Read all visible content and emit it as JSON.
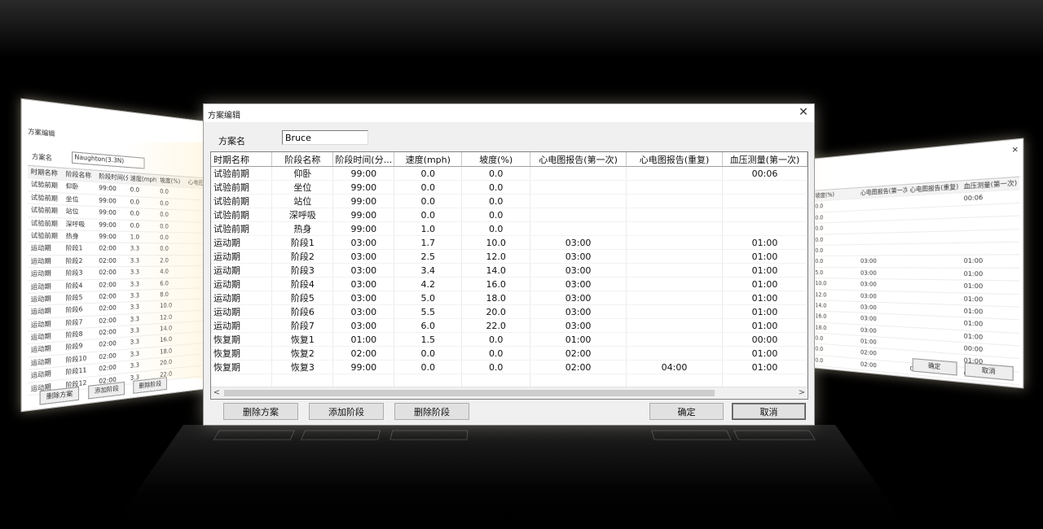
{
  "dialog": {
    "title": "方案编辑",
    "close_glyph": "✕",
    "plan_label": "方案名",
    "plan_value": "Bruce",
    "columns": [
      "时期名称",
      "阶段名称",
      "阶段时间(分...",
      "速度(mph)",
      "坡度(%)",
      "心电图报告(第一次)",
      "心电图报告(重复)",
      "血压测量(第一次)"
    ],
    "rows": [
      [
        "试验前期",
        "仰卧",
        "99:00",
        "0.0",
        "0.0",
        "",
        "",
        "00:06"
      ],
      [
        "试验前期",
        "坐位",
        "99:00",
        "0.0",
        "0.0",
        "",
        "",
        ""
      ],
      [
        "试验前期",
        "站位",
        "99:00",
        "0.0",
        "0.0",
        "",
        "",
        ""
      ],
      [
        "试验前期",
        "深呼吸",
        "99:00",
        "0.0",
        "0.0",
        "",
        "",
        ""
      ],
      [
        "试验前期",
        "热身",
        "99:00",
        "1.0",
        "0.0",
        "",
        "",
        ""
      ],
      [
        "运动期",
        "阶段1",
        "03:00",
        "1.7",
        "10.0",
        "03:00",
        "",
        "01:00"
      ],
      [
        "运动期",
        "阶段2",
        "03:00",
        "2.5",
        "12.0",
        "03:00",
        "",
        "01:00"
      ],
      [
        "运动期",
        "阶段3",
        "03:00",
        "3.4",
        "14.0",
        "03:00",
        "",
        "01:00"
      ],
      [
        "运动期",
        "阶段4",
        "03:00",
        "4.2",
        "16.0",
        "03:00",
        "",
        "01:00"
      ],
      [
        "运动期",
        "阶段5",
        "03:00",
        "5.0",
        "18.0",
        "03:00",
        "",
        "01:00"
      ],
      [
        "运动期",
        "阶段6",
        "03:00",
        "5.5",
        "20.0",
        "03:00",
        "",
        "01:00"
      ],
      [
        "运动期",
        "阶段7",
        "03:00",
        "6.0",
        "22.0",
        "03:00",
        "",
        "01:00"
      ],
      [
        "恢复期",
        "恢复1",
        "01:00",
        "1.5",
        "0.0",
        "01:00",
        "",
        "00:00"
      ],
      [
        "恢复期",
        "恢复2",
        "02:00",
        "0.0",
        "0.0",
        "02:00",
        "",
        "01:00"
      ],
      [
        "恢复期",
        "恢复3",
        "99:00",
        "0.0",
        "0.0",
        "02:00",
        "04:00",
        "01:00"
      ]
    ],
    "buttons": {
      "delete_plan": "删除方案",
      "add_stage": "添加阶段",
      "delete_stage": "删除阶段",
      "ok": "确定",
      "cancel": "取消"
    },
    "scroll_left": "<",
    "scroll_right": ">"
  },
  "left_dialog": {
    "title": "方案编辑",
    "plan_label": "方案名",
    "plan_value": "Naughton(3.3N)",
    "columns": [
      "时期名称",
      "阶段名称",
      "阶段时间(分...",
      "速度(mph)",
      "坡度(%)",
      "心电图"
    ],
    "rows": [
      [
        "试验前期",
        "仰卧",
        "99:00",
        "0.0",
        "0.0"
      ],
      [
        "试验前期",
        "坐位",
        "99:00",
        "0.0",
        "0.0"
      ],
      [
        "试验前期",
        "站位",
        "99:00",
        "0.0",
        "0.0"
      ],
      [
        "试验前期",
        "深呼吸",
        "99:00",
        "0.0",
        "0.0"
      ],
      [
        "试验前期",
        "热身",
        "99:00",
        "1.0",
        "0.0"
      ],
      [
        "运动期",
        "阶段1",
        "02:00",
        "3.3",
        "0.0"
      ],
      [
        "运动期",
        "阶段2",
        "02:00",
        "3.3",
        "2.0"
      ],
      [
        "运动期",
        "阶段3",
        "02:00",
        "3.3",
        "4.0"
      ],
      [
        "运动期",
        "阶段4",
        "02:00",
        "3.3",
        "6.0"
      ],
      [
        "运动期",
        "阶段5",
        "02:00",
        "3.3",
        "8.0"
      ],
      [
        "运动期",
        "阶段6",
        "02:00",
        "3.3",
        "10.0"
      ],
      [
        "运动期",
        "阶段7",
        "02:00",
        "3.3",
        "12.0"
      ],
      [
        "运动期",
        "阶段8",
        "02:00",
        "3.3",
        "14.0"
      ],
      [
        "运动期",
        "阶段9",
        "02:00",
        "3.3",
        "16.0"
      ],
      [
        "运动期",
        "阶段10",
        "02:00",
        "3.3",
        "18.0"
      ],
      [
        "运动期",
        "阶段11",
        "02:00",
        "3.3",
        "20.0"
      ],
      [
        "运动期",
        "阶段12",
        "02:00",
        "3.3",
        "22.0"
      ]
    ],
    "buttons": [
      "删除方案",
      "添加阶段",
      "删除阶段"
    ]
  },
  "right_dialog": {
    "close_glyph": "✕",
    "columns": [
      "坡度(%)",
      "心电图报告(第一次)",
      "心电图报告(重复)",
      "血压测量(第一次)"
    ],
    "rows": [
      [
        "0.0",
        "",
        "",
        "00:06"
      ],
      [
        "0.0",
        "",
        "",
        ""
      ],
      [
        "0.0",
        "",
        "",
        ""
      ],
      [
        "0.0",
        "",
        "",
        ""
      ],
      [
        "0.0",
        "",
        "",
        ""
      ],
      [
        "0.0",
        "03:00",
        "",
        "01:00"
      ],
      [
        "5.0",
        "03:00",
        "",
        "01:00"
      ],
      [
        "10.0",
        "03:00",
        "",
        "01:00"
      ],
      [
        "12.0",
        "03:00",
        "",
        "01:00"
      ],
      [
        "14.0",
        "03:00",
        "",
        "01:00"
      ],
      [
        "16.0",
        "03:00",
        "",
        "01:00"
      ],
      [
        "18.0",
        "03:00",
        "",
        "01:00"
      ],
      [
        "0.0",
        "01:00",
        "",
        "00:00"
      ],
      [
        "0.0",
        "02:00",
        "",
        "01:00"
      ],
      [
        "0.0",
        "02:00",
        "04:00",
        "01:00"
      ]
    ],
    "buttons": [
      "确定",
      "取消"
    ]
  }
}
